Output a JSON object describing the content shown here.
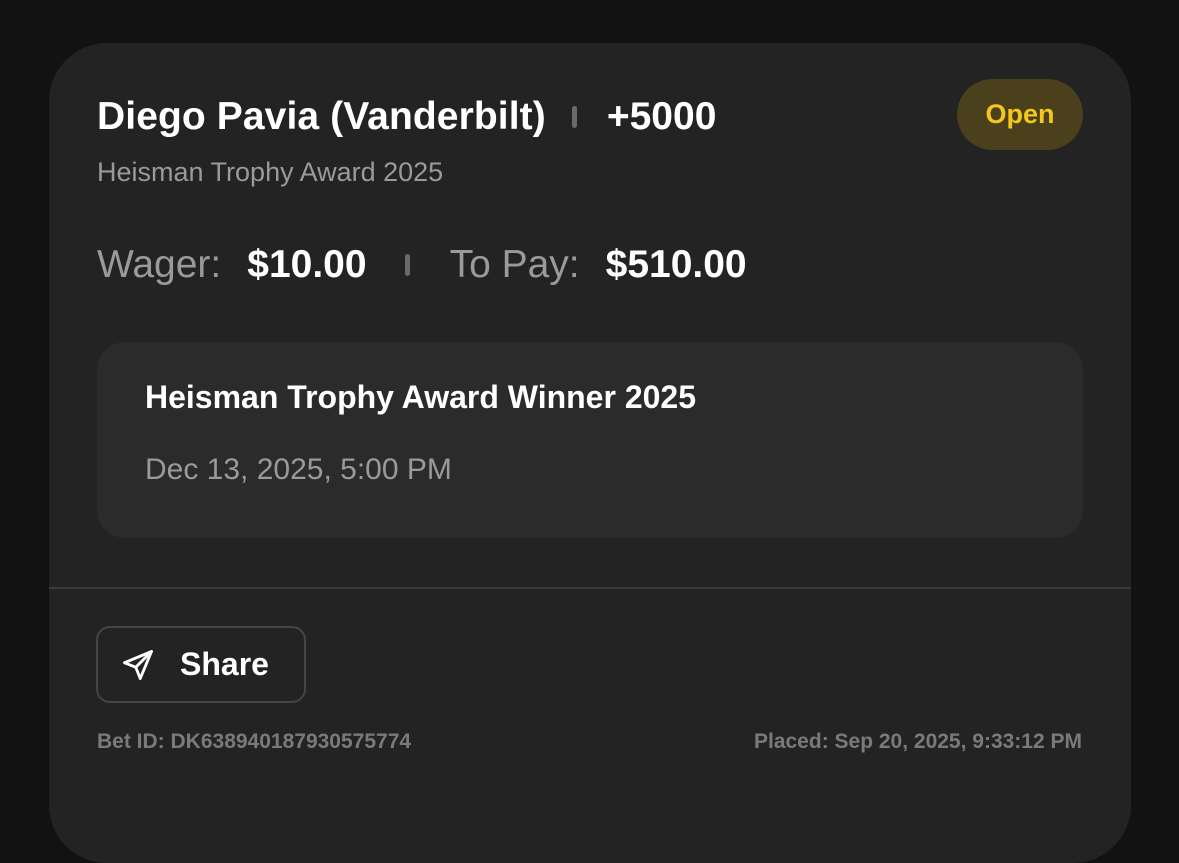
{
  "bet": {
    "selection": "Diego Pavia (Vanderbilt)",
    "odds": "+5000",
    "status": "Open",
    "market": "Heisman Trophy Award 2025",
    "wager_label": "Wager:",
    "wager_value": "$10.00",
    "to_pay_label": "To Pay:",
    "to_pay_value": "$510.00"
  },
  "event": {
    "title": "Heisman Trophy Award Winner 2025",
    "date": "Dec 13, 2025, 5:00 PM"
  },
  "actions": {
    "share_label": "Share",
    "share_icon": "paper-plane-icon"
  },
  "footer": {
    "bet_id": "Bet ID: DK638940187930575774",
    "placed": "Placed: Sep 20, 2025, 9:33:12 PM"
  },
  "colors": {
    "background": "#121212",
    "card": "#232323",
    "status_text": "#f4c81a",
    "status_bg": "#4a401c"
  }
}
